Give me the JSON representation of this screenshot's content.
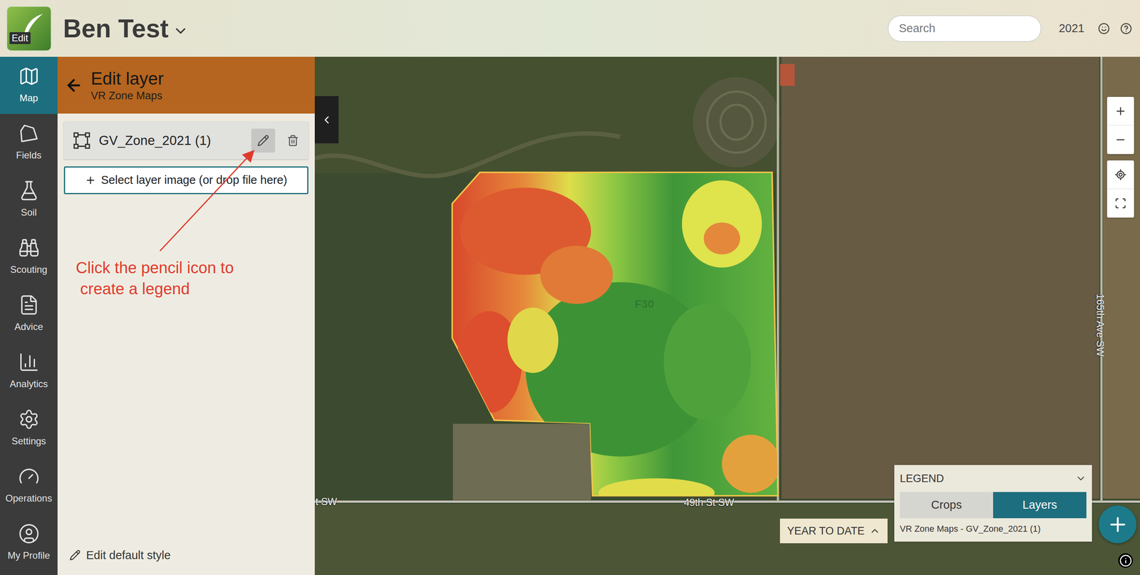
{
  "header": {
    "logo_badge": "Edit",
    "title": "Ben Test",
    "search_placeholder": "Search",
    "year": "2021"
  },
  "nav": [
    {
      "label": "Map",
      "selected": true
    },
    {
      "label": "Fields",
      "selected": false
    },
    {
      "label": "Soil",
      "selected": false
    },
    {
      "label": "Scouting",
      "selected": false
    },
    {
      "label": "Advice",
      "selected": false
    },
    {
      "label": "Analytics",
      "selected": false
    },
    {
      "label": "Settings",
      "selected": false
    },
    {
      "label": "Operations",
      "selected": false
    },
    {
      "label": "My Profile",
      "selected": false
    }
  ],
  "panel": {
    "title": "Edit layer",
    "subtitle": "VR Zone Maps",
    "layers": [
      {
        "name": "GV_Zone_2021 (1)",
        "edit_highlighted": true
      }
    ],
    "upload_button": "Select layer image (or drop file here)",
    "footer": "Edit default style"
  },
  "annotation": {
    "lines": [
      "Click the pencil icon to",
      " create a legend"
    ]
  },
  "map": {
    "labels": [
      {
        "text": "F30",
        "kind": "field"
      },
      {
        "text": "49th St SW",
        "kind": "road-bottom"
      },
      {
        "text": "t SW",
        "kind": "road-bottom-cut"
      },
      {
        "text": "165th Ave SW",
        "kind": "road-vertical"
      }
    ],
    "year_button": "YEAR TO DATE",
    "legend": {
      "title": "LEGEND",
      "expanded": true,
      "tabs": [
        {
          "label": "Crops",
          "selected": false
        },
        {
          "label": "Layers",
          "selected": true
        }
      ],
      "entries": [
        "VR Zone Maps - GV_Zone_2021 (1)"
      ]
    }
  }
}
